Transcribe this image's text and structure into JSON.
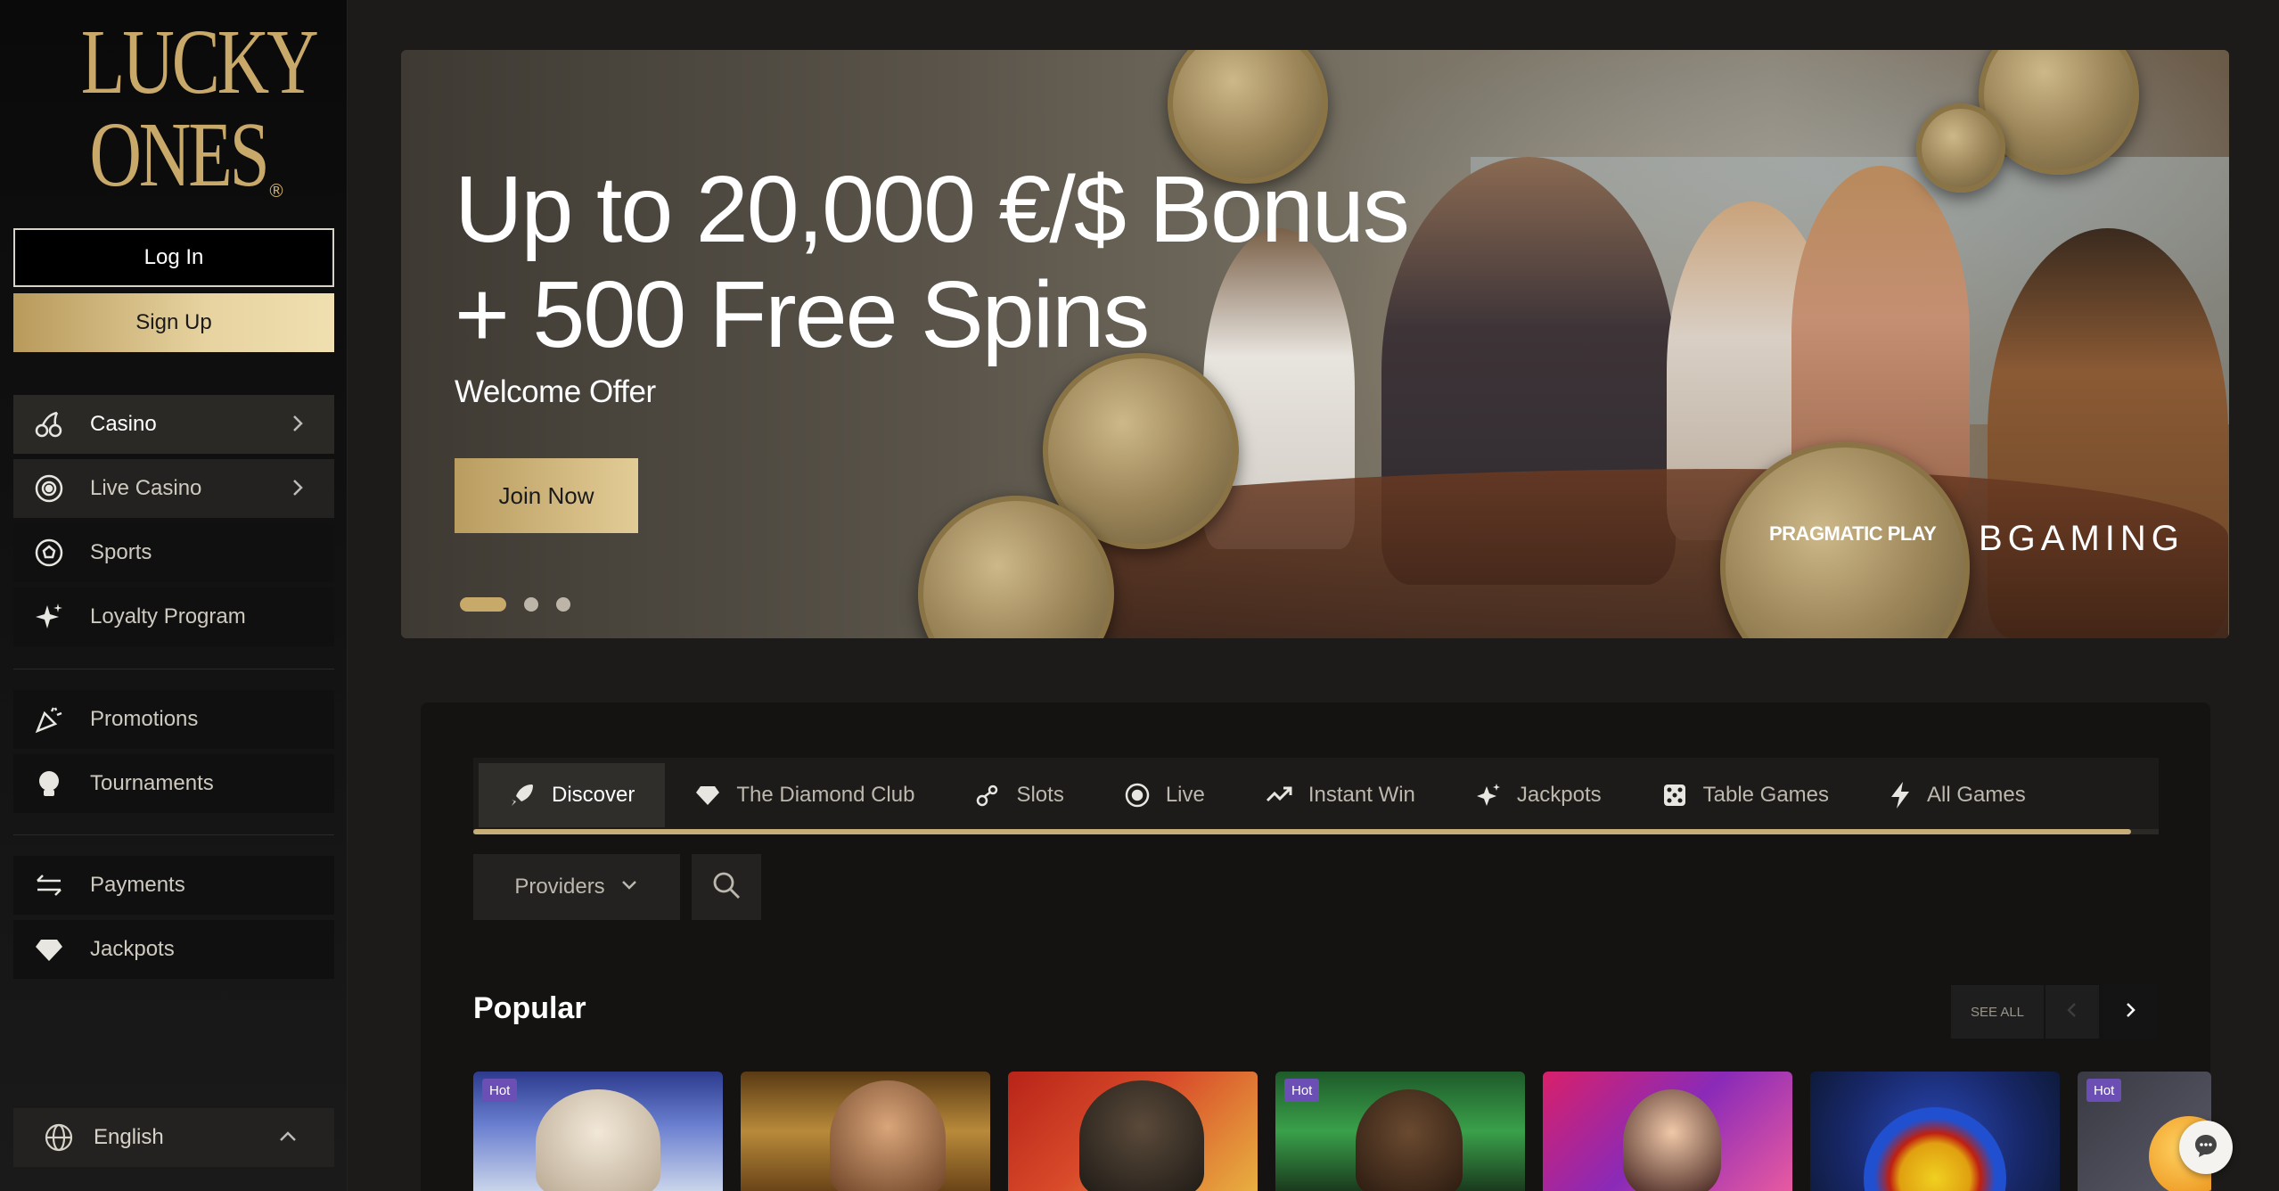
{
  "brand": {
    "line1": "LUCKY",
    "line2": "ONES",
    "reg": "®"
  },
  "auth": {
    "login": "Log In",
    "signup": "Sign Up"
  },
  "sidebar": {
    "items": [
      {
        "label": "Casino",
        "icon": "cherries-icon"
      },
      {
        "label": "Live Casino",
        "icon": "chip-icon"
      },
      {
        "label": "Sports",
        "icon": "soccer-ball-icon"
      },
      {
        "label": "Loyalty Program",
        "icon": "sparkles-icon"
      },
      {
        "label": "Promotions",
        "icon": "party-popper-icon"
      },
      {
        "label": "Tournaments",
        "icon": "trophy-icon"
      },
      {
        "label": "Payments",
        "icon": "transfer-arrows-icon"
      },
      {
        "label": "Jackpots",
        "icon": "diamond-icon"
      }
    ],
    "language": "English"
  },
  "hero": {
    "title_line1": "Up to 20,000 €/$ Bonus",
    "title_line2": "+ 500 Free Spins",
    "subtitle": "Welcome Offer",
    "cta": "Join Now",
    "provider1": "PRAGMATIC PLAY",
    "provider2": "BGAMING",
    "slides": 3,
    "active_slide": 1
  },
  "games": {
    "tabs": [
      {
        "label": "Discover",
        "icon": "rocket-icon"
      },
      {
        "label": "The Diamond Club",
        "icon": "diamond-icon"
      },
      {
        "label": "Slots",
        "icon": "slot-icon"
      },
      {
        "label": "Live",
        "icon": "chip-icon"
      },
      {
        "label": "Instant Win",
        "icon": "trend-icon"
      },
      {
        "label": "Jackpots",
        "icon": "sparkles-icon"
      },
      {
        "label": "Table Games",
        "icon": "dice-icon"
      },
      {
        "label": "All Games",
        "icon": "lightning-icon"
      }
    ],
    "providers_label": "Providers",
    "section_title": "Popular",
    "see_all": "SEE ALL",
    "hot_badge": "Hot",
    "cards": [
      {
        "hot": true
      },
      {
        "hot": false
      },
      {
        "hot": false
      },
      {
        "hot": true
      },
      {
        "hot": false
      },
      {
        "hot": false
      },
      {
        "hot": true
      }
    ]
  },
  "colors": {
    "accent_gold": "#c7a96a",
    "background": "#1c1b19",
    "hot_badge": "#6c4fb5"
  }
}
